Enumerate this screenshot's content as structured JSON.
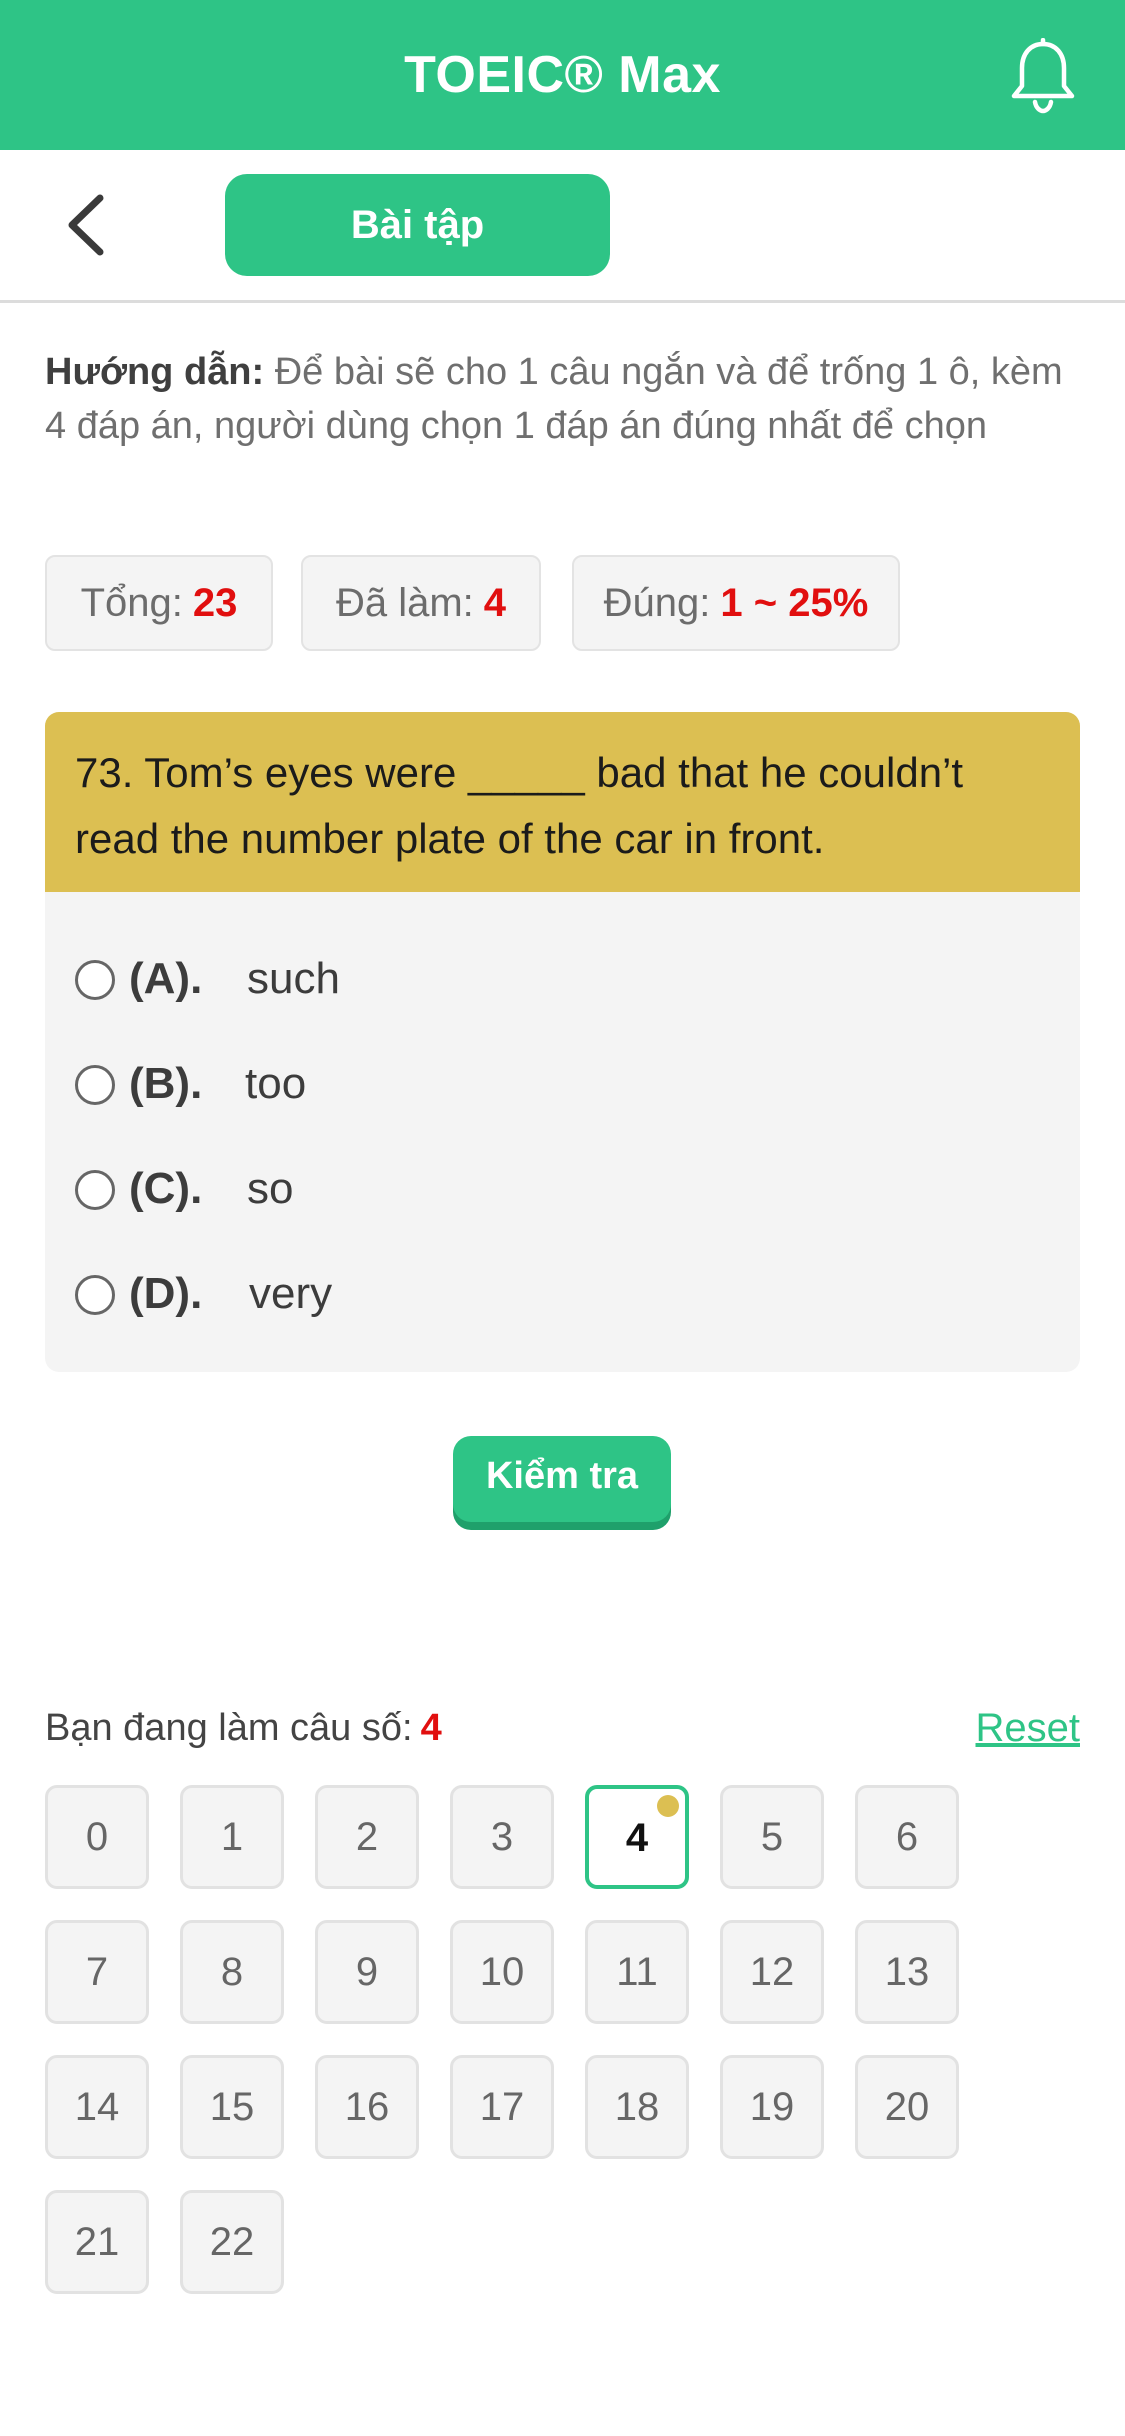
{
  "header": {
    "app_title": "TOEIC® Max",
    "accent_color": "#2ec486",
    "notification_icon": "bell-icon"
  },
  "subheader": {
    "back_icon": "chevron-left-icon",
    "tab_label": "Bài tập"
  },
  "instructions": {
    "lead": "Hướng dẫn:",
    "text": "Để bài sẽ cho 1 câu ngắn và để trống 1 ô, kèm 4 đáp án, người dùng chọn 1 đáp án đúng nhất để chọn"
  },
  "stats": {
    "total_label": "Tổng:",
    "total_value": "23",
    "done_label": "Đã làm:",
    "done_value": "4",
    "correct_label": "Đúng:",
    "correct_value": "1 ~ 25%"
  },
  "question": {
    "text": "73. Tom’s eyes were _____ bad that he couldn’t read the number plate of the car in front.",
    "header_color": "#dcbf52",
    "options": [
      {
        "letter": "(A).",
        "text": "such"
      },
      {
        "letter": "(B).",
        "text": "too"
      },
      {
        "letter": "(C).",
        "text": "so"
      },
      {
        "letter": "(D).",
        "text": "very"
      }
    ]
  },
  "check_button": "Kiểm tra",
  "navigator": {
    "current_label": "Bạn đang làm câu số:",
    "current_value": "4",
    "reset_label": "Reset",
    "numbers": [
      "0",
      "1",
      "2",
      "3",
      "4",
      "5",
      "6",
      "7",
      "8",
      "9",
      "10",
      "11",
      "12",
      "13",
      "14",
      "15",
      "16",
      "17",
      "18",
      "19",
      "20",
      "21",
      "22"
    ],
    "active_index": 4
  }
}
